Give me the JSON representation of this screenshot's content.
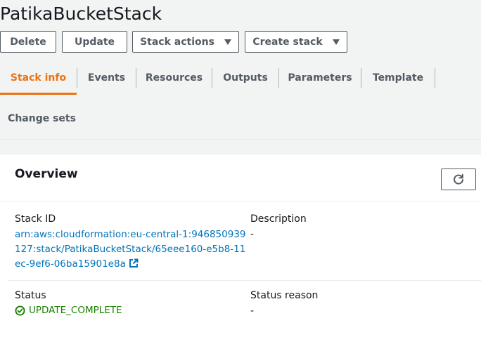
{
  "page": {
    "title": "PatikaBucketStack"
  },
  "toolbar": {
    "delete_label": "Delete",
    "update_label": "Update",
    "stack_actions_label": "Stack actions",
    "create_stack_label": "Create stack"
  },
  "tabs": [
    {
      "label": "Stack info",
      "active": true
    },
    {
      "label": "Events"
    },
    {
      "label": "Resources"
    },
    {
      "label": "Outputs"
    },
    {
      "label": "Parameters"
    },
    {
      "label": "Template"
    },
    {
      "label": "Change sets"
    }
  ],
  "overview": {
    "title": "Overview",
    "stack_id_label": "Stack ID",
    "stack_id_value": "arn:aws:cloudformation:eu-central-1:946850939127:stack/PatikaBucketStack/65eee160-e5b8-11ec-9ef6-06ba15901e8a",
    "description_label": "Description",
    "description_value": "-",
    "status_label": "Status",
    "status_value": "UPDATE_COMPLETE",
    "status_reason_label": "Status reason",
    "status_reason_value": "-"
  },
  "colors": {
    "accent": "#ec7211",
    "link": "#0073bb",
    "success": "#1d8102",
    "background": "#f2f3f3"
  },
  "icons": {
    "caret": "caret-down-icon",
    "refresh": "refresh-icon",
    "external_link": "external-link-icon",
    "status": "check-circle-icon"
  }
}
